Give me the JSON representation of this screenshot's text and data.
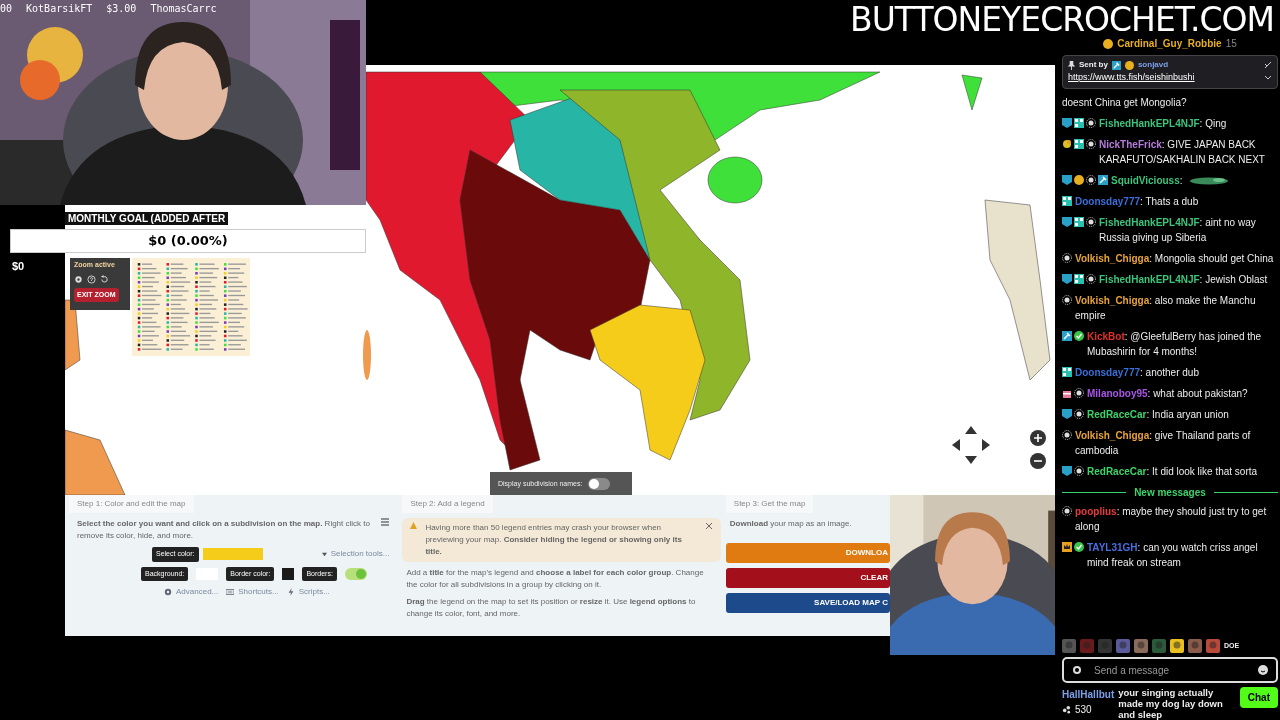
{
  "ticker": [
    "00",
    "KotBarsikFT",
    "$3.00",
    "ThomasCarrc"
  ],
  "goal": {
    "title": "MONTHLY GOAL (ADDED AFTER",
    "amount": "$0 (0.00%)",
    "level": 0,
    "raised": "$0"
  },
  "zoom_panel": {
    "title": "Zoom active",
    "exit_button": "EXIT ZOOM"
  },
  "map": {
    "subdivision_names": {
      "label": "Display subdivision names:",
      "on": false
    }
  },
  "steps": [
    {
      "kind": "color",
      "title": "Step 1: Color and edit the map",
      "text": "**Select the color you want and click on a subdivision on the map.** Right click to remove its color, hide, and more.",
      "select_color": {
        "label": "Select color:",
        "color": "#f5cc1a"
      },
      "selection_tools": "Selection tools...",
      "background": {
        "label": "Background:",
        "color": "#ffffff"
      },
      "border_color": {
        "label": "Border color:",
        "color": "#1a1a1a"
      },
      "borders": {
        "label": "Borders:",
        "on": true
      },
      "links": [
        {
          "label": "Advanced...",
          "kind": "gear"
        },
        {
          "label": "Shortcuts...",
          "kind": "keyboard"
        },
        {
          "label": "Scripts...",
          "kind": "bolt"
        }
      ]
    },
    {
      "kind": "legend",
      "title": "Step 2: Add a legend",
      "alert": "Having more than 50 legend entries may crash your browser when previewing your map. **Consider hiding the legend or showing only its title.**",
      "paragraphs": [
        "Add a **title** for the map's legend and **choose a label for each color group**. Change the color for all subdivisions in a group by clicking on it.",
        "**Drag** the legend on the map to set its position or **resize** it. Use **legend options** to change its color, font, and more."
      ]
    },
    {
      "kind": "download",
      "title": "Step 3: Get the map",
      "text": "**Download** your map as an image.",
      "buttons": [
        {
          "label": "DOWNLOA",
          "color": "#e07b12"
        },
        {
          "label": "CLEAR",
          "color": "#a3101c"
        },
        {
          "label": "SAVE/LOAD MAP C",
          "color": "#1d4a8a"
        }
      ]
    }
  ],
  "logo": "BUTTONEYECROCHET.COM",
  "chat": {
    "top_user": {
      "name": "Cardinal_Guy_Robbie",
      "count": "15"
    },
    "pinned": {
      "label": "Sent by",
      "user": "sonjavd",
      "link": "https://www.tts.fish/seishinbushi"
    },
    "messages": [
      {
        "kind": "message",
        "text": "doesnt China get Mongolia?"
      },
      {
        "kind": "message",
        "user": "FishedHankEPL4NJF",
        "color": "#3cc47c",
        "badges": [
          {
            "kind": "sub"
          },
          {
            "kind": "grid"
          },
          {
            "kind": "star"
          }
        ],
        "text": ": Qing"
      },
      {
        "kind": "message",
        "user": "NickTheFrick",
        "color": "#b57bdc",
        "badges": [
          {
            "kind": "cheer"
          },
          {
            "kind": "grid"
          },
          {
            "kind": "star"
          }
        ],
        "text": ": GIVE JAPAN BACK KARAFUTO/SAKHALIN BACK NEXT"
      },
      {
        "kind": "message",
        "user": "SquidViciouss",
        "color": "#3cc47c",
        "badges": [
          {
            "kind": "sub"
          },
          {
            "kind": "coin"
          },
          {
            "kind": "star"
          },
          {
            "kind": "hammer"
          }
        ],
        "text": ":",
        "emote": true
      },
      {
        "kind": "message",
        "user": "Doonsday777",
        "color": "#3a6fd8",
        "badges": [
          {
            "kind": "grid"
          }
        ],
        "text": ": Thats a dub"
      },
      {
        "kind": "message",
        "user": "FishedHankEPL4NJF",
        "color": "#3cc47c",
        "badges": [
          {
            "kind": "sub"
          },
          {
            "kind": "grid"
          },
          {
            "kind": "star"
          }
        ],
        "text": ": aint no way Russia giving up Siberia"
      },
      {
        "kind": "message",
        "user": "Volkish_Chigga",
        "color": "#e8a33a",
        "badges": [
          {
            "kind": "star"
          }
        ],
        "text": ": Mongolia should get China"
      },
      {
        "kind": "message",
        "user": "FishedHankEPL4NJF",
        "color": "#3cc47c",
        "badges": [
          {
            "kind": "sub"
          },
          {
            "kind": "grid"
          },
          {
            "kind": "star"
          }
        ],
        "text": ": Jewish Oblast"
      },
      {
        "kind": "message",
        "user": "Volkish_Chigga",
        "color": "#e8a33a",
        "badges": [
          {
            "kind": "star"
          }
        ],
        "text": ": also make the Manchu empire"
      },
      {
        "kind": "message",
        "user": "KickBot",
        "color": "#e0302a",
        "badges": [
          {
            "kind": "hammer"
          },
          {
            "kind": "check"
          }
        ],
        "text": ": @GleefulBerry has joined the Mubashirin for 4 months!"
      },
      {
        "kind": "message",
        "user": "Doonsday777",
        "color": "#3a6fd8",
        "badges": [
          {
            "kind": "grid"
          }
        ],
        "text": ": another dub"
      },
      {
        "kind": "message",
        "user": "Milanoboy95",
        "color": "#a855e8",
        "badges": [
          {
            "kind": "gift"
          },
          {
            "kind": "star"
          }
        ],
        "text": ": what about pakistan?"
      },
      {
        "kind": "message",
        "user": "RedRaceCar",
        "color": "#3cd46a",
        "badges": [
          {
            "kind": "sub"
          },
          {
            "kind": "star"
          }
        ],
        "text": ": India aryan union"
      },
      {
        "kind": "message",
        "user": "Volkish_Chigga",
        "color": "#e8a33a",
        "badges": [
          {
            "kind": "star"
          }
        ],
        "text": ": give Thailand parts of cambodia"
      },
      {
        "kind": "message",
        "user": "RedRaceCar",
        "color": "#3cd46a",
        "badges": [
          {
            "kind": "sub"
          },
          {
            "kind": "star"
          }
        ],
        "text": ": It did look like that sorta"
      },
      {
        "kind": "divider",
        "text": "New messages"
      },
      {
        "kind": "message",
        "user": "pooplius",
        "color": "#e83a3a",
        "badges": [
          {
            "kind": "star"
          }
        ],
        "text": ": maybe they should just try to get along"
      },
      {
        "kind": "message",
        "user": "TAYL31GH",
        "color": "#4a6ee0",
        "badges": [
          {
            "kind": "crown"
          },
          {
            "kind": "check"
          }
        ],
        "text": ": can you watch criss angel mind freak on stream"
      }
    ],
    "emote_label": "DOE",
    "input": {
      "placeholder": "Send a message"
    },
    "tts": {
      "user": "HallHallbut",
      "text": "your singing actually made my dog lay down and sleep"
    },
    "points": "530",
    "chat_button": "Chat"
  }
}
